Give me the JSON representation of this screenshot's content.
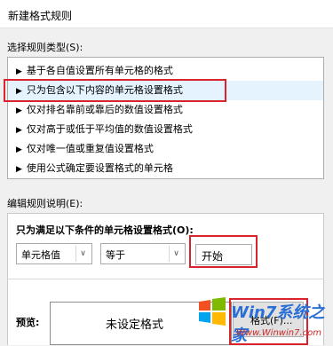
{
  "dialog": {
    "title": "新建格式规则"
  },
  "rule_type": {
    "label": "选择规则类型(S):",
    "items": [
      {
        "label": "基于各自值设置所有单元格的格式"
      },
      {
        "label": "只为包含以下内容的单元格设置格式"
      },
      {
        "label": "仅对排名靠前或靠后的数值设置格式"
      },
      {
        "label": "仅对高于或低于平均值的数值设置格式"
      },
      {
        "label": "仅对唯一值或重复值设置格式"
      },
      {
        "label": "使用公式确定要设置格式的单元格"
      }
    ],
    "selected_index": 1
  },
  "edit": {
    "label": "编辑规则说明(E):",
    "condition_label": "只为满足以下条件的单元格设置格式(O):",
    "field1": {
      "value": "单元格值"
    },
    "operator": {
      "value": "等于"
    },
    "text_value": "开始"
  },
  "preview": {
    "label": "预览:",
    "text": "未设定格式",
    "format_button": "格式(F)..."
  },
  "watermark": {
    "title": "Win7系统之家",
    "url": "Www.Winwin7.com"
  },
  "colors": {
    "highlight_border": "#d9232d",
    "selected_row": "#e5f3ff",
    "watermark_blue": "#2a6fd6"
  }
}
